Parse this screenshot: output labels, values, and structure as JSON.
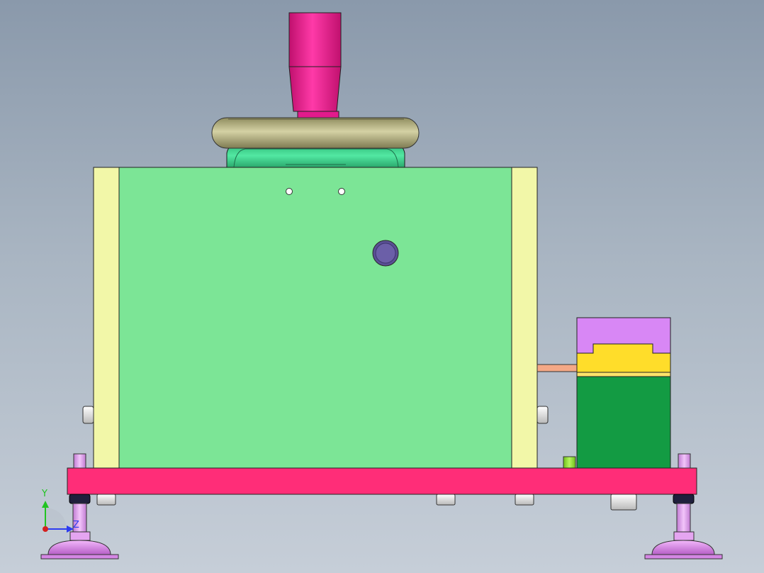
{
  "triad": {
    "y_label": "Y",
    "z_label": "Z",
    "y_color": "#22c322",
    "z_color": "#2d3cf0",
    "x_color": "#d42020"
  },
  "colors": {
    "background_top": "#8a99ab",
    "background_bottom": "#c6ced8",
    "sprue_bushing": "#ee1c96",
    "locating_ring": "#b9b583",
    "core_insert": "#39d890",
    "mold_plate": "#7ce596",
    "side_clamp_plates": "#f2f7a8",
    "base_plate": "#ff2d78",
    "leveling_feet": "#e18ff0",
    "cylinder_top": "#d887f5",
    "cylinder_middle": "#ffdd2a",
    "cylinder_body": "#139b43",
    "connector_rod": "#f4a886",
    "cooling_plug": "#6b5fa8",
    "green_pin": "#8ce42b"
  }
}
